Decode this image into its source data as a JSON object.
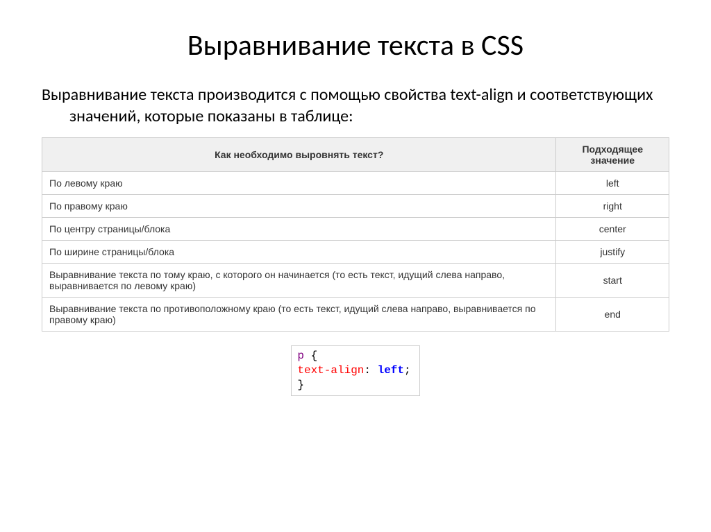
{
  "title": "Выравнивание текста в CSS",
  "intro": "Выравнивание текста производится с помощью свойства text-align и соответствующих значений, которые показаны в таблице:",
  "table": {
    "header": {
      "question": "Как необходимо выровнять текст?",
      "value": "Подходящее значение"
    },
    "rows": [
      {
        "desc": "По левому краю",
        "value": "left"
      },
      {
        "desc": "По правому краю",
        "value": "right"
      },
      {
        "desc": "По центру страницы/блока",
        "value": "center"
      },
      {
        "desc": "По ширине страницы/блока",
        "value": "justify"
      },
      {
        "desc": "Выравнивание текста по тому краю, с которого он начинается (то есть текст, идущий слева направо, выравнивается по левому краю)",
        "value": "start"
      },
      {
        "desc": "Выравнивание текста по противоположному краю (то есть текст, идущий слева направо, выравнивается по правому краю)",
        "value": "end"
      }
    ]
  },
  "code": {
    "selector": "p",
    "brace_open": " {",
    "property": "text-align",
    "colon": ": ",
    "value": "left",
    "semicolon": ";",
    "brace_close": "}"
  }
}
